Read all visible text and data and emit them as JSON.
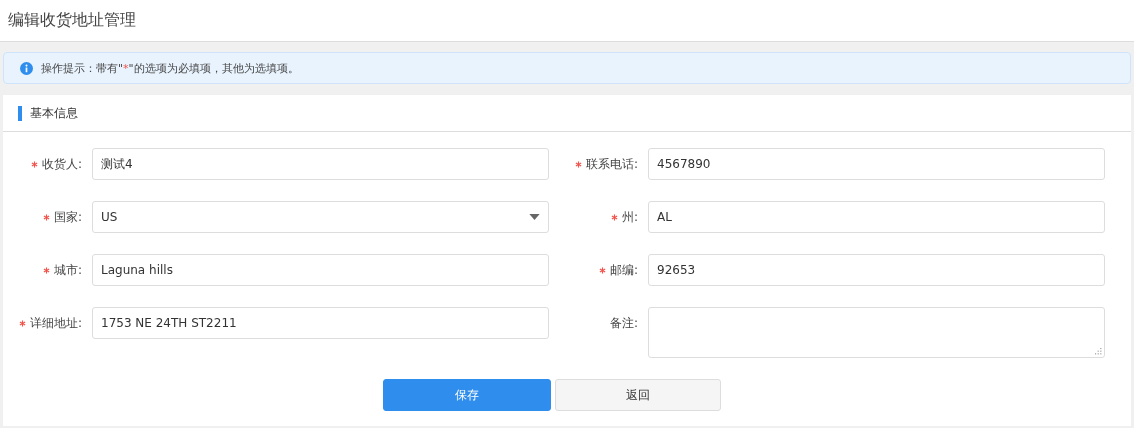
{
  "page_title": "编辑收货地址管理",
  "hint": {
    "before": "操作提示：带有\"",
    "mark": "*",
    "after": "\"的选项为必填项，其他为选填项。"
  },
  "section": {
    "title": "基本信息"
  },
  "fields": [
    {
      "label": "收货人:",
      "required": true,
      "kind": "text",
      "value": "测试4"
    },
    {
      "label": "联系电话:",
      "required": true,
      "kind": "text",
      "value": "4567890"
    },
    {
      "label": "国家:",
      "required": true,
      "kind": "select",
      "value": "US"
    },
    {
      "label": "州:",
      "required": true,
      "kind": "text",
      "value": "AL"
    },
    {
      "label": "城市:",
      "required": true,
      "kind": "text",
      "value": "Laguna hills"
    },
    {
      "label": "邮编:",
      "required": true,
      "kind": "text",
      "value": "92653"
    },
    {
      "label": "详细地址:",
      "required": true,
      "kind": "text",
      "value": "1753 NE 24TH ST2211"
    },
    {
      "label": "备注:",
      "required": false,
      "kind": "textarea"
    }
  ],
  "buttons": [
    {
      "label": "保存",
      "kind": "primary"
    },
    {
      "label": "返回",
      "kind": "default"
    }
  ]
}
